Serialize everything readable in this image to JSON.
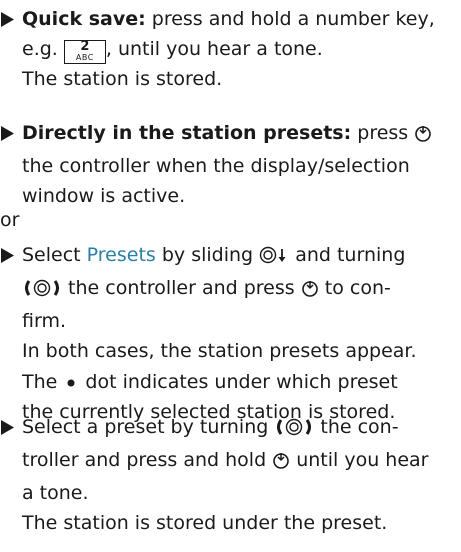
{
  "steps": {
    "quick_save": {
      "label": "Quick save:",
      "line1_rest": " press and hold a number key,",
      "line2_pre": "e.g. ",
      "key_number": "2",
      "key_letters": "ABC",
      "line2_post": ", until you hear a tone.",
      "result": "The station is stored."
    },
    "direct": {
      "label": "Directly in the station presets:",
      "line1_rest": " press",
      "line2": "the controller when the display/selection",
      "line3": "window is active."
    },
    "or_text": "or",
    "select_presets": {
      "line1_pre": "Select ",
      "menu_term": "Presets",
      "line1_post": " by sliding",
      "line1_end": " and turning",
      "line2_post": " the controller and press",
      "line2_end": " to con-",
      "line3": "firm.",
      "info1": "In both cases, the station presets appear.",
      "info2_pre": "The ",
      "info2_post": " dot indicates under which preset",
      "info3": "the currently selected station is stored."
    },
    "select_preset": {
      "line1_pre": "Select a preset by turning",
      "line1_post": " the con-",
      "line2_pre": "troller and press and hold",
      "line2_post": " until you hear",
      "line3": "a tone.",
      "result": "The station is stored under the preset."
    }
  },
  "icons": {
    "bullet": "bullet-triangle-icon",
    "press": "controller-press-icon",
    "slide": "controller-slide-down-icon",
    "turn": "controller-turn-icon",
    "dot": "preset-dot-icon"
  },
  "colors": {
    "menu_term": "#2a7fa6"
  }
}
